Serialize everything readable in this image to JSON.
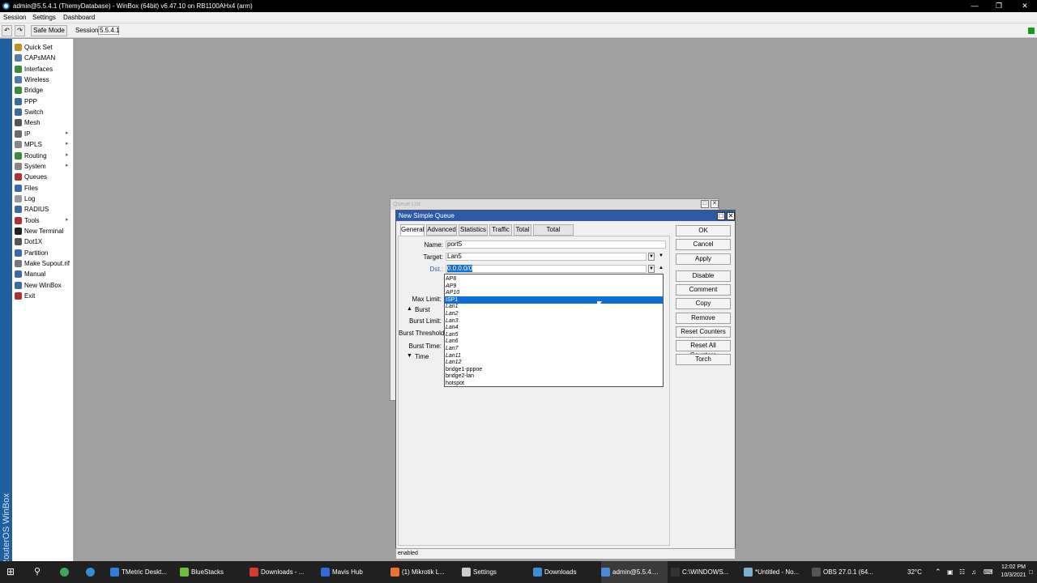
{
  "window": {
    "title": "admin@5.5.4.1 (ThemyDatabase) - WinBox (64bit) v6.47.10 on RB1100AHx4 (arm)",
    "controls": [
      "—",
      "❐",
      "✕"
    ]
  },
  "menu": [
    "Session",
    "Settings",
    "Dashboard"
  ],
  "toolbar": {
    "undo": "↶",
    "redo": "↷",
    "safe_mode": "Safe Mode",
    "session_label": "Session:",
    "session_value": "5.5.4.1"
  },
  "brand": "RouterOS WinBox",
  "sidebar": {
    "items": [
      {
        "label": "Quick Set",
        "color": "#c09020"
      },
      {
        "label": "CAPsMAN",
        "color": "#5a7aa8"
      },
      {
        "label": "Interfaces",
        "color": "#3a8a3a"
      },
      {
        "label": "Wireless",
        "color": "#4a7ab0"
      },
      {
        "label": "Bridge",
        "color": "#3a8a3a"
      },
      {
        "label": "PPP",
        "color": "#3a6aa8"
      },
      {
        "label": "Switch",
        "color": "#3a6aa8"
      },
      {
        "label": "Mesh",
        "color": "#555555"
      },
      {
        "label": "IP",
        "color": "#6a6a6a",
        "arrow": "▸"
      },
      {
        "label": "MPLS",
        "color": "#888888",
        "arrow": "▸"
      },
      {
        "label": "Routing",
        "color": "#3a8a3a",
        "arrow": "▸"
      },
      {
        "label": "System",
        "color": "#888888",
        "arrow": "▸"
      },
      {
        "label": "Queues",
        "color": "#b03030"
      },
      {
        "label": "Files",
        "color": "#3a6aa8"
      },
      {
        "label": "Log",
        "color": "#999999"
      },
      {
        "label": "RADIUS",
        "color": "#3a6aa8"
      },
      {
        "label": "Tools",
        "color": "#b03030",
        "arrow": "▸"
      },
      {
        "label": "New Terminal",
        "color": "#222222"
      },
      {
        "label": "Dot1X",
        "color": "#555555"
      },
      {
        "label": "Partition",
        "color": "#3a6aa8"
      },
      {
        "label": "Make Supout.rif",
        "color": "#777777"
      },
      {
        "label": "Manual",
        "color": "#3a6aa8"
      },
      {
        "label": "New WinBox",
        "color": "#3a6aa8"
      },
      {
        "label": "Exit",
        "color": "#b03030"
      }
    ]
  },
  "queue_list": {
    "title": "Queue List"
  },
  "dialog": {
    "title": "New Simple Queue",
    "tabs": [
      "General",
      "Advanced",
      "Statistics",
      "Traffic",
      "Total",
      "Total Statistics"
    ],
    "fields": {
      "name_label": "Name:",
      "name_value": "port5",
      "target_label": "Target:",
      "target_value": "Lan5",
      "dst_label": "Dst.:",
      "dst_value": "0.0.0.0/0",
      "max_limit_label": "Max Limit:",
      "burst_label": "Burst",
      "burst_limit_label": "Burst Limit:",
      "burst_threshold_label": "Burst Threshold:",
      "burst_time_label": "Burst Time:",
      "time_label": "Time"
    },
    "buttons": [
      "OK",
      "Cancel",
      "Apply",
      "Disable",
      "Comment",
      "Copy",
      "Remove",
      "Reset Counters",
      "Reset All Counters",
      "Torch"
    ],
    "status": "enabled"
  },
  "dropdown": {
    "options": [
      {
        "label": "AP8",
        "italic": false
      },
      {
        "label": "AP9",
        "italic": true
      },
      {
        "label": "AP10",
        "italic": true
      },
      {
        "label": "ISP1",
        "italic": false,
        "selected": true
      },
      {
        "label": "Lan1",
        "italic": true
      },
      {
        "label": "Lan2",
        "italic": true
      },
      {
        "label": "Lan3",
        "italic": true
      },
      {
        "label": "Lan4",
        "italic": true
      },
      {
        "label": "Lan5",
        "italic": true
      },
      {
        "label": "Lan6",
        "italic": true
      },
      {
        "label": "Lan7",
        "italic": true
      },
      {
        "label": "Lan11",
        "italic": true
      },
      {
        "label": "Lan12",
        "italic": true
      },
      {
        "label": "bridge1-pppoe",
        "italic": false
      },
      {
        "label": "bridge2-lan",
        "italic": false
      },
      {
        "label": "hotspot",
        "italic": false
      }
    ]
  },
  "taskbar": {
    "apps": [
      {
        "label": "TMetric Deskt...",
        "color": "#2e7dd8"
      },
      {
        "label": "BlueStacks",
        "color": "#6bbf3a"
      },
      {
        "label": "Downloads - ...",
        "color": "#d83b2e"
      },
      {
        "label": "Mavis Hub",
        "color": "#2e6bd8"
      },
      {
        "label": "(1) Mikrotik L...",
        "color": "#e8732a"
      },
      {
        "label": "Settings",
        "color": "#cccccc"
      },
      {
        "label": "Downloads",
        "color": "#3a8ed8"
      },
      {
        "label": "admin@5.5.4....",
        "color": "#4a8ad8",
        "active": true
      },
      {
        "label": "C:\\WINDOWS...",
        "color": "#333333"
      },
      {
        "label": "*Untitled - No...",
        "color": "#7ab0d8"
      },
      {
        "label": "OBS 27.0.1 (64...",
        "color": "#555555"
      }
    ],
    "temperature": "32°C",
    "time": "12:02 PM",
    "date": "10/3/2021"
  }
}
